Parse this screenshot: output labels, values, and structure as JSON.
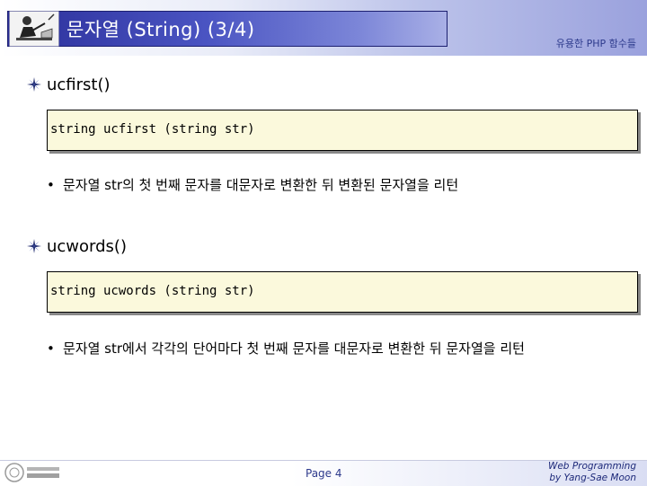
{
  "header": {
    "title": "문자열 (String) (3/4)",
    "subtitle": "유용한 PHP 함수들"
  },
  "sections": [
    {
      "heading": "ucfirst()",
      "code": "string ucfirst (string str)",
      "description": "문자열 str의 첫 번째 문자를 대문자로 변환한 뒤 변환된 문자열을 리턴"
    },
    {
      "heading": "ucwords()",
      "code": "string ucwords (string str)",
      "description": "문자열 str에서 각각의 단어마다 첫 번째 문자를 대문자로 변환한 뒤 문자열을 리턴"
    }
  ],
  "footer": {
    "page": "Page 4",
    "credit_line1": "Web Programming",
    "credit_line2": "by Yang-Sae Moon"
  },
  "icons": {
    "header_logo": "person-at-desk-icon",
    "bullet": "compass-bullet-icon",
    "footer_logo": "university-logo-icon"
  },
  "colors": {
    "title_bar": "#3a42b0",
    "code_background": "#fbf9dc",
    "subtitle_text": "#2d3a8c"
  }
}
